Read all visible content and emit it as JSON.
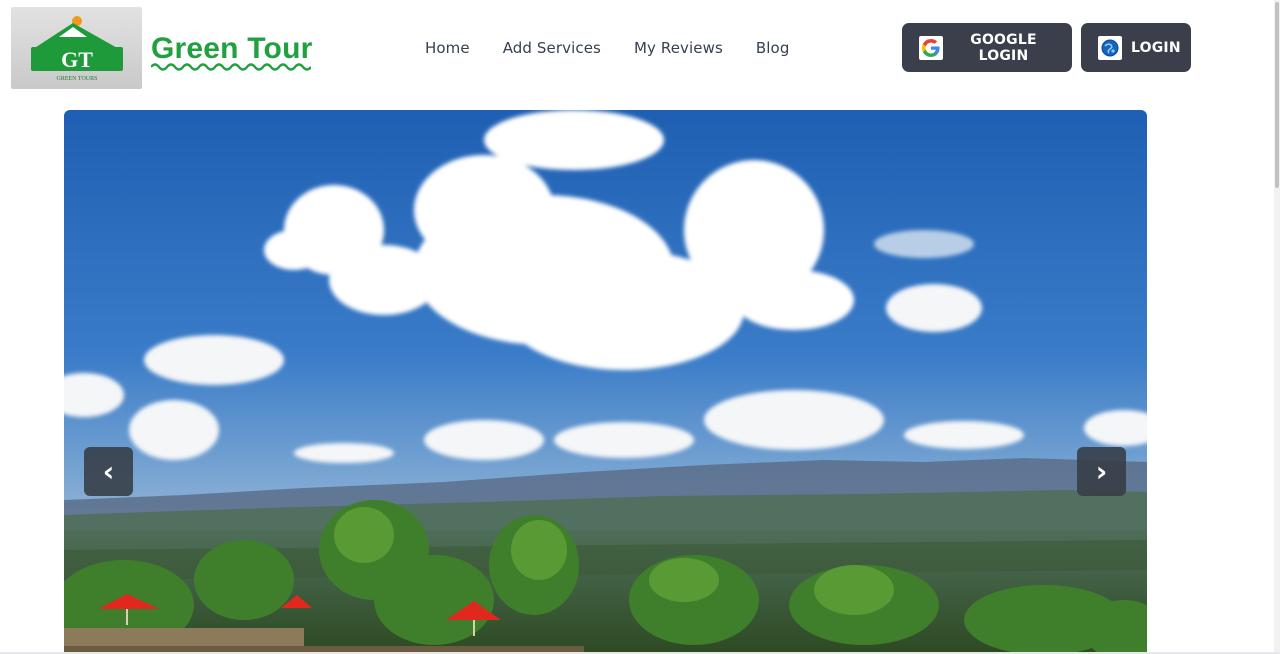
{
  "brand": {
    "name": "Green Tour",
    "logo_monogram": "GT",
    "logo_caption": "GREEN TOURS"
  },
  "nav": {
    "links": [
      {
        "label": "Home"
      },
      {
        "label": "Add Services"
      },
      {
        "label": "My Reviews"
      },
      {
        "label": "Blog"
      }
    ]
  },
  "auth": {
    "google_label": "GOOGLE LOGIN",
    "login_label": "LOGIN"
  },
  "carousel": {
    "prev_symbol": "‹",
    "next_symbol": "›"
  },
  "colors": {
    "brand_green": "#21a040",
    "button_dark": "#3a3f4b",
    "nav_text": "#374151"
  },
  "icons": {
    "google": "google-icon",
    "login": "globe-icon",
    "prev": "chevron-left-icon",
    "next": "chevron-right-icon"
  }
}
